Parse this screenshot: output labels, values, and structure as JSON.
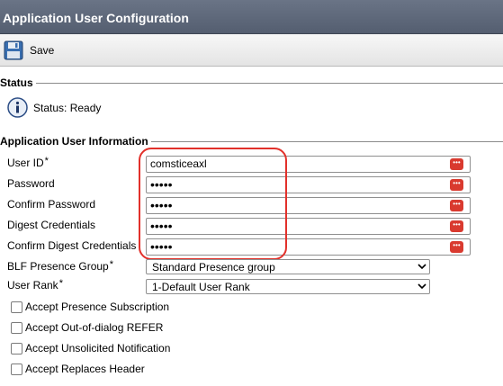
{
  "header": {
    "title": "Application User Configuration"
  },
  "toolbar": {
    "save_label": "Save"
  },
  "status_section": {
    "title": "Status",
    "status_text": "Status: Ready"
  },
  "info_section": {
    "title": "Application User Information",
    "fields": [
      {
        "label": "User ID",
        "required": "*",
        "value": "comsticeaxl"
      },
      {
        "label": "Password",
        "value": "•••••"
      },
      {
        "label": "Confirm Password",
        "value": "•••••"
      },
      {
        "label": "Digest Credentials",
        "value": "•••••"
      },
      {
        "label": "Confirm Digest Credentials",
        "value": "•••••"
      }
    ],
    "selects": [
      {
        "label": "BLF Presence Group",
        "required": "*",
        "value": "Standard Presence group"
      },
      {
        "label": "User Rank",
        "required": "*",
        "value": "1-Default User Rank"
      }
    ],
    "checkboxes": [
      {
        "label": "Accept Presence Subscription",
        "checked": false
      },
      {
        "label": "Accept Out-of-dialog REFER",
        "checked": false
      },
      {
        "label": "Accept Unsolicited Notification",
        "checked": false
      },
      {
        "label": "Accept Replaces Header",
        "checked": false
      }
    ]
  },
  "icons": {
    "save": "floppy-disk-icon",
    "status": "info-icon",
    "field_badge": "keyboard-dots-icon"
  },
  "colors": {
    "title_bar": "#5f6879",
    "highlight": "#e2312b",
    "badge": "#d93a2f"
  }
}
